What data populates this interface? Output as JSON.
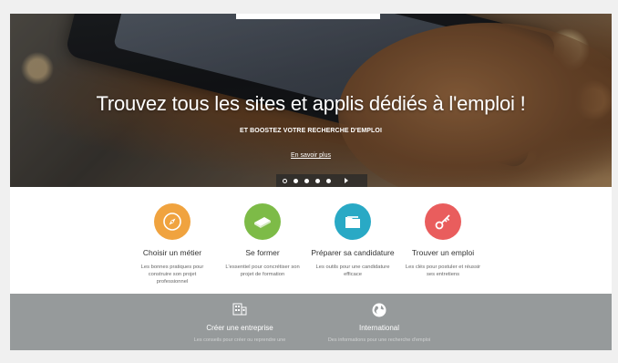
{
  "hero": {
    "title": "Trouvez tous les sites et applis dédiés à l'emploi !",
    "subtitle": "ET BOOSTEZ VOTRE RECHERCHE D'EMPLOI",
    "link": "En savoir plus",
    "slides_count": 5,
    "active_slide": 1
  },
  "features": [
    {
      "title": "Choisir un métier",
      "desc": "Les bonnes pratiques pour construire son projet professionnel",
      "color": "#f0a33f",
      "icon": "compass-icon"
    },
    {
      "title": "Se former",
      "desc": "L'essentiel pour concrétiser son projet de formation",
      "color": "#7dbb47",
      "icon": "book-icon"
    },
    {
      "title": "Préparer sa candidature",
      "desc": "Les outils pour une candidature efficace",
      "color": "#29a9c5",
      "icon": "folder-icon"
    },
    {
      "title": "Trouver un emploi",
      "desc": "Les clés pour postuler et réussir ses entretiens",
      "color": "#e95d5d",
      "icon": "key-icon"
    }
  ],
  "band": [
    {
      "title": "Créer une entreprise",
      "desc": "Les conseils pour créer ou reprendre une",
      "icon": "building-icon"
    },
    {
      "title": "International",
      "desc": "Des informations pour une recherche d'emploi",
      "icon": "globe-icon"
    }
  ]
}
